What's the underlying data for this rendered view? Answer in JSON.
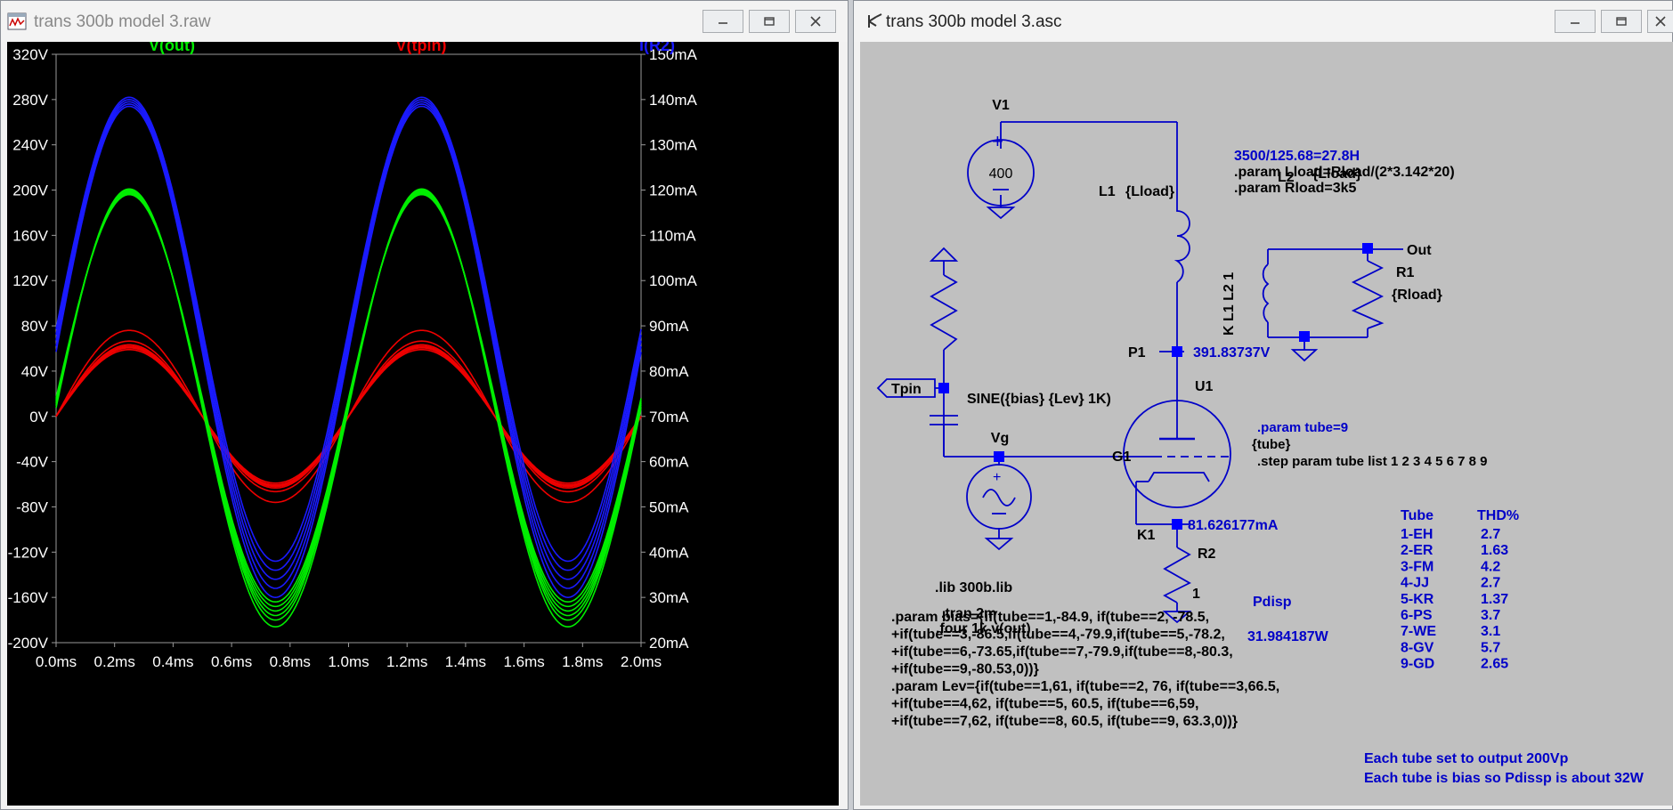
{
  "waveform_window": {
    "title": "trans 300b model 3.raw",
    "icon": "waveform-icon",
    "controls": [
      "minimize",
      "maximize",
      "close"
    ]
  },
  "schematic_window": {
    "title": "trans 300b model 3.asc",
    "icon": "schematic-icon",
    "controls": [
      "minimize",
      "maximize",
      "close"
    ]
  },
  "chart_data": {
    "type": "line",
    "background": "#000000",
    "grid": false,
    "x": {
      "label": "",
      "unit": "ms",
      "range": [
        0,
        2.0
      ],
      "ticks": [
        "0.0ms",
        "0.2ms",
        "0.4ms",
        "0.6ms",
        "0.8ms",
        "1.0ms",
        "1.2ms",
        "1.4ms",
        "1.6ms",
        "1.8ms",
        "2.0ms"
      ]
    },
    "y_left": {
      "unit": "V",
      "range": [
        -200,
        320
      ],
      "ticks": [
        "320V",
        "280V",
        "240V",
        "200V",
        "160V",
        "120V",
        "80V",
        "40V",
        "0V",
        "-40V",
        "-80V",
        "-120V",
        "-160V",
        "-200V"
      ]
    },
    "y_right": {
      "unit": "mA",
      "range": [
        20,
        150
      ],
      "ticks": [
        "150mA",
        "140mA",
        "130mA",
        "120mA",
        "110mA",
        "100mA",
        "90mA",
        "80mA",
        "70mA",
        "60mA",
        "50mA",
        "40mA",
        "30mA",
        "20mA"
      ]
    },
    "legend": [
      {
        "name": "V(out)",
        "color": "#00ee00"
      },
      {
        "name": "V(tpin)",
        "color": "#ee0000"
      },
      {
        "name": "I(R2)",
        "color": "#1a1aff"
      }
    ],
    "series": [
      {
        "name": "V(out)",
        "axis": "left",
        "color": "#00ee00",
        "frequency_khz": 1,
        "traces": [
          {
            "peak": 201,
            "trough": -186
          },
          {
            "peak": 200,
            "trough": -180
          },
          {
            "peak": 199,
            "trough": -176
          },
          {
            "peak": 198,
            "trough": -172
          },
          {
            "peak": 197,
            "trough": -168
          },
          {
            "peak": 196,
            "trough": -164
          }
        ]
      },
      {
        "name": "V(tpin)",
        "axis": "left",
        "color": "#ee0000",
        "frequency_khz": 1,
        "traces": [
          {
            "peak": 76,
            "trough": -76
          },
          {
            "peak": 66.5,
            "trough": -66.5
          },
          {
            "peak": 63.3,
            "trough": -63.3
          },
          {
            "peak": 62,
            "trough": -62
          },
          {
            "peak": 61,
            "trough": -61
          },
          {
            "peak": 60.5,
            "trough": -60.5
          },
          {
            "peak": 59,
            "trough": -59
          }
        ]
      },
      {
        "name": "I(R2)",
        "axis": "right",
        "color": "#1a1aff",
        "frequency_khz": 1,
        "unit": "mA",
        "traces": [
          {
            "peak": 140.5,
            "trough": 38
          },
          {
            "peak": 140,
            "trough": 36
          },
          {
            "peak": 139.5,
            "trough": 34
          },
          {
            "peak": 139,
            "trough": 32
          },
          {
            "peak": 138.5,
            "trough": 30
          }
        ]
      }
    ]
  },
  "schematic": {
    "v1_label": "V1",
    "v1_value": "400",
    "note1": "3500/125.68=27.8H",
    "note2": ".param Lload=Rload/(2*3.142*20)",
    "note3": ".param Rload=3k5",
    "l1_label": "L1",
    "l1_value": "{Lload}",
    "l2_label": "L2",
    "l2_value": "{Lload}",
    "coupling": "K L1 L2 1",
    "out_label": "Out",
    "r1_label": "R1",
    "r1_value": "{Rload}",
    "p1_label": "P1",
    "p1_voltage": "391.83737V",
    "tpin_label": "Tpin",
    "u1_label": "U1",
    "sine": "SINE({bias} {Lev} 1K)",
    "vg_label": "Vg",
    "g1_label": "G1",
    "param_tube": ".param tube=9",
    "tube_label": "{tube}",
    "step": ".step param tube list 1 2 3 4 5 6 7 8 9",
    "k1_label": "K1",
    "k1_current": "81.626177mA",
    "r2_label": "R2",
    "r2_value": "1",
    "lib": ".lib 300b.lib",
    "tran": ".tran 2m",
    "four": ".four 1k v(out)",
    "pdisp_label": "Pdisp",
    "pdisp_value": "31.984187W",
    "table_header": {
      "tube": "Tube",
      "thd": "THD%"
    },
    "table_rows": [
      {
        "tube": "1-EH",
        "thd": "2.7"
      },
      {
        "tube": "2-ER",
        "thd": "1.63"
      },
      {
        "tube": "3-FM",
        "thd": "4.2"
      },
      {
        "tube": "4-JJ",
        "thd": "2.7"
      },
      {
        "tube": "5-KR",
        "thd": "1.37"
      },
      {
        "tube": "6-PS",
        "thd": "3.7"
      },
      {
        "tube": "7-WE",
        "thd": "3.1"
      },
      {
        "tube": "8-GV",
        "thd": "5.7"
      },
      {
        "tube": "9-GD",
        "thd": "2.65"
      }
    ],
    "bias_lines": [
      ".param bias={if(tube==1,-84.9, if(tube==2, -78.5,",
      "+if(tube==3,-86.5,if(tube==4,-79.9,if(tube==5,-78.2,",
      "+if(tube==6,-73.65,if(tube==7,-79.9,if(tube==8,-80.3,",
      "+if(tube==9,-80.53,0))}"
    ],
    "lev_lines": [
      ".param Lev={if(tube==1,61, if(tube==2, 76, if(tube==3,66.5,",
      "+if(tube==4,62, if(tube==5, 60.5, if(tube==6,59,",
      "+if(tube==7,62, if(tube==8, 60.5, if(tube==9, 63.3,0))}"
    ],
    "note_output": "Each tube set to output 200Vp",
    "note_bias": "Each tube is bias so Pdissp is about 32W"
  }
}
